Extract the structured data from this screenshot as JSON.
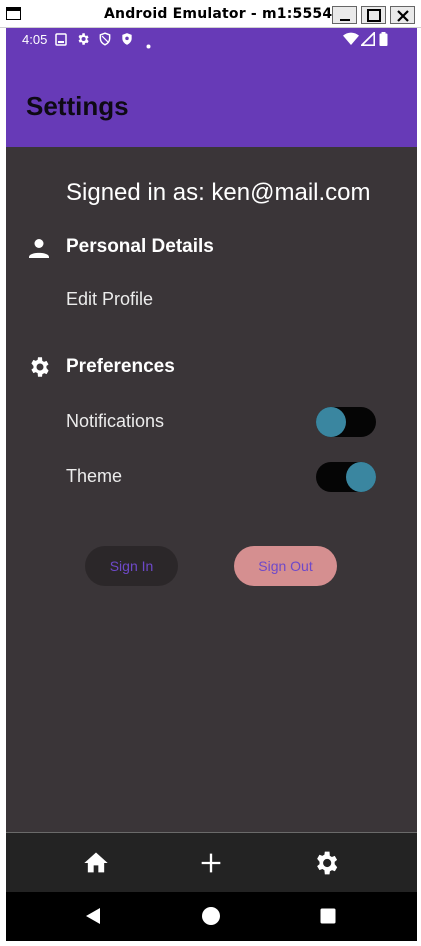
{
  "window": {
    "title": "Android Emulator - m1:5554"
  },
  "status_bar": {
    "time": "4:05",
    "icons": [
      "sim-icon",
      "gear-icon",
      "shield-icon",
      "shield-filled-icon",
      "dot-icon",
      "wifi-icon",
      "signal-icon",
      "battery-icon"
    ]
  },
  "header": {
    "title": "Settings",
    "color": "#673ab7"
  },
  "account": {
    "signed_in_text": "Signed in as: ken@mail.com"
  },
  "sections": {
    "personal": {
      "title": "Personal Details",
      "icon": "person-icon",
      "items": {
        "edit_profile": "Edit Profile"
      }
    },
    "preferences": {
      "title": "Preferences",
      "icon": "gear-icon",
      "items": {
        "notifications": {
          "label": "Notifications",
          "on": false
        },
        "theme": {
          "label": "Theme",
          "on": true
        }
      }
    }
  },
  "buttons": {
    "sign_in": "Sign In",
    "sign_out": "Sign Out"
  },
  "bottom_nav": {
    "items": [
      "home-icon",
      "add-icon",
      "settings-icon"
    ]
  },
  "system_nav": {
    "items": [
      "back-icon",
      "home-circle-icon",
      "recents-icon"
    ]
  },
  "colors": {
    "background": "#3a3538",
    "toggle_track": "#050505",
    "toggle_knob": "#3a86a0",
    "sign_out_bg": "#d58f90",
    "button_text": "#6e49c9"
  }
}
